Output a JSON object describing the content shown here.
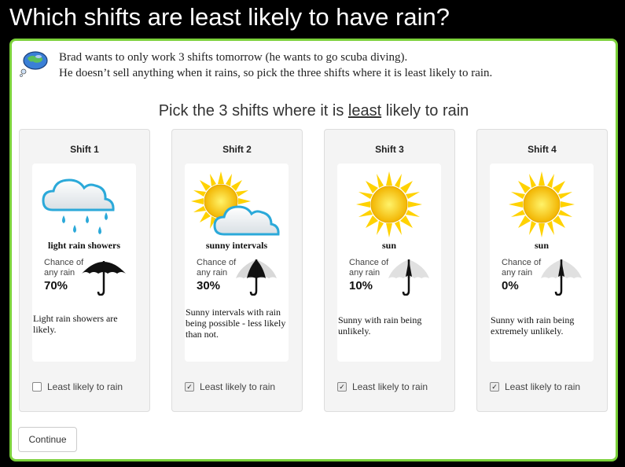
{
  "title": "Which shifts are least likely to have rain?",
  "intro": {
    "line1": "Brad wants to only work 3 shifts tomorrow (he wants to go scuba diving).",
    "line2": "He doesn’t sell anything when it rains, so pick the three shifts where it is least likely to rain."
  },
  "prompt": {
    "before": "Pick the 3 shifts where it is ",
    "emph": "least",
    "after": " likely to rain"
  },
  "chance_label_1": "Chance of",
  "chance_label_2": "any rain",
  "checkbox_label": "Least likely to rain",
  "shifts": [
    {
      "title": "Shift 1",
      "weather": "light rain showers",
      "icon": "rain-cloud-icon",
      "percent": "70%",
      "rain_fraction": 0.7,
      "umbrella": "open-umbrella-icon",
      "description": "Light rain showers are likely.",
      "checked": false
    },
    {
      "title": "Shift 2",
      "weather": "sunny intervals",
      "icon": "sun-cloud-icon",
      "percent": "30%",
      "rain_fraction": 0.3,
      "umbrella": "half-open-umbrella-icon",
      "description": "Sunny intervals with rain being possible - less likely than not.",
      "checked": true
    },
    {
      "title": "Shift 3",
      "weather": "sun",
      "icon": "sun-icon",
      "percent": "10%",
      "rain_fraction": 0.1,
      "umbrella": "closed-umbrella-icon",
      "description": "Sunny with rain being unlikely.",
      "checked": true
    },
    {
      "title": "Shift 4",
      "weather": "sun",
      "icon": "sun-icon",
      "percent": "0%",
      "rain_fraction": 0.0,
      "umbrella": "closed-umbrella-icon",
      "description": "Sunny with rain being extremely unlikely.",
      "checked": true
    }
  ],
  "continue_label": "Continue",
  "colors": {
    "accent_border": "#7bd13a",
    "rain_blue": "#2ba9d9",
    "sun_yellow": "#ffd200"
  }
}
